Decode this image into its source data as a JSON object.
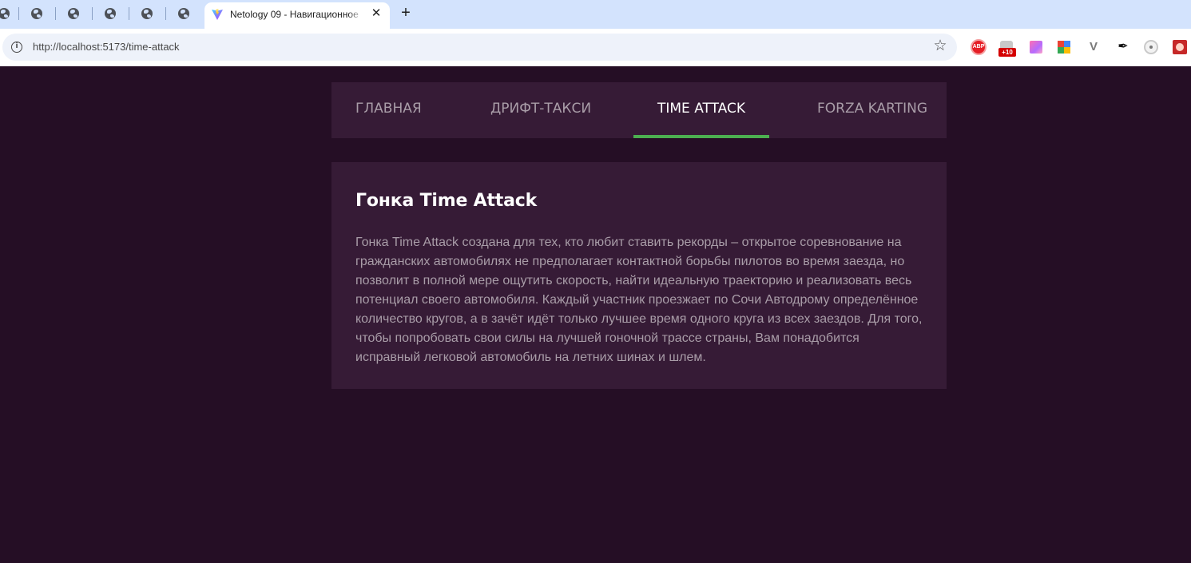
{
  "browser": {
    "active_tab": {
      "title": "Netology 09 - Навигационное"
    },
    "address_bar": {
      "url": "http://localhost:5173/time-attack"
    },
    "extensions": {
      "abp_label": "ABP",
      "badge_text": "+10"
    }
  },
  "nav": {
    "items": [
      {
        "label": "ГЛАВНАЯ",
        "active": false
      },
      {
        "label": "ДРИФТ-ТАКСИ",
        "active": false
      },
      {
        "label": "TIME ATTACK",
        "active": true
      },
      {
        "label": "FORZA KARTING",
        "active": false
      }
    ]
  },
  "article": {
    "title": "Гонка Time Attack",
    "body": "Гонка Time Attack создана для тех, кто любит ставить рекорды – открытое соревнование на гражданских автомобилях не предполагает контактной борьбы пилотов во время заезда, но позволит в полной мере ощутить скорость, найти идеальную траекторию и реализовать весь потенциал своего автомобиля. Каждый участник проезжает по Сочи Автодрому определённое количество кругов, а в зачёт идёт только лучшее время одного круга из всех заездов. Для того, чтобы попробовать свои силы на лучшей гоночной трассе страны, Вам понадобится исправный легковой автомобиль на летних шинах и шлем."
  },
  "colors": {
    "page_bg": "#250e25",
    "panel_bg": "#361b36",
    "active_underline": "#4caf50",
    "muted_text": "#a99da8"
  }
}
